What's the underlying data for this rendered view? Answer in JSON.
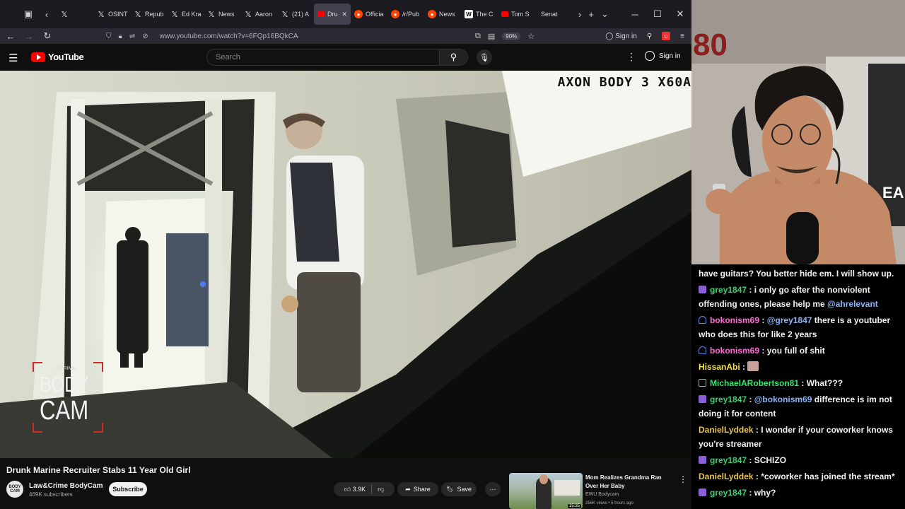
{
  "browser": {
    "tabs": [
      {
        "label": "",
        "icon": "x-logo",
        "type": "x",
        "active": false
      },
      {
        "label": "OSINT",
        "icon": "x-logo",
        "type": "x",
        "active": false
      },
      {
        "label": "Repub",
        "icon": "x-logo",
        "type": "x",
        "active": false
      },
      {
        "label": "Ed Kra",
        "icon": "x-logo",
        "type": "x",
        "active": false
      },
      {
        "label": "News",
        "icon": "x-logo",
        "type": "x",
        "active": false
      },
      {
        "label": "Aaron",
        "icon": "x-logo",
        "type": "x",
        "active": false
      },
      {
        "label": "(21) A",
        "icon": "x-logo",
        "type": "x",
        "active": false
      },
      {
        "label": "Dru",
        "icon": "youtube-logo",
        "type": "yt",
        "active": true
      },
      {
        "label": "Officia",
        "icon": "reddit-logo",
        "type": "rd",
        "active": false
      },
      {
        "label": "/r/Pub",
        "icon": "reddit-logo",
        "type": "rd",
        "active": false
      },
      {
        "label": "News",
        "icon": "reddit-logo",
        "type": "rd",
        "active": false
      },
      {
        "label": "The C",
        "icon": "wikipedia-logo",
        "type": "w",
        "active": false
      },
      {
        "label": "Tom S",
        "icon": "youtube-logo",
        "type": "yt",
        "active": false
      },
      {
        "label": "Senat",
        "icon": "",
        "type": "none",
        "active": false
      }
    ],
    "url": "www.youtube.com/watch?v=6FQp16BQkCA",
    "zoom": "90%",
    "sign_in": "Sign in"
  },
  "youtube": {
    "logo_text": "YouTube",
    "search_placeholder": "Search",
    "sign_in": "Sign in"
  },
  "video": {
    "overlay_text": "AXON BODY 3  X60A",
    "watermark_small": "& CRIME",
    "watermark_line1": "BODY",
    "watermark_line2": "CAM",
    "title": "Drunk Marine Recruiter Stabs 11 Year Old Girl",
    "channel": "Law&Crime BodyCam",
    "channel_avatar_text": "BODY CAM",
    "subscribers": "469K subscribers",
    "subscribe_label": "Subscribe",
    "likes": "3.9K",
    "share_label": "Share",
    "save_label": "Save"
  },
  "recommendation": {
    "title": "Mom Realizes Grandma Ran Over Her Baby",
    "channel": "EWU Bodycam",
    "meta": "258K views • 5 hours ago",
    "duration": "15:35"
  },
  "chat": {
    "messages": [
      {
        "user": "",
        "color": "#f2f2f2",
        "badge": "",
        "parts": [
          {
            "t": "text",
            "v": "have guitars? You better hide em. I will show up."
          }
        ]
      },
      {
        "user": "grey1847",
        "color": "#3bd16f",
        "badge": "sub",
        "parts": [
          {
            "t": "text",
            "v": "i only go after the nonviolent offending ones, please help me "
          },
          {
            "t": "mention",
            "v": "@ahrelevant"
          }
        ]
      },
      {
        "user": "bokonism69",
        "color": "#ff6bd6",
        "badge": "user",
        "parts": [
          {
            "t": "mention",
            "v": "@grey1847"
          },
          {
            "t": "text",
            "v": " there is a youtuber who does this for like 2 years"
          }
        ]
      },
      {
        "user": "bokonism69",
        "color": "#ff6bd6",
        "badge": "user",
        "parts": [
          {
            "t": "text",
            "v": "you full of shit"
          }
        ]
      },
      {
        "user": "HissanAbi",
        "color": "#f5e642",
        "badge": "",
        "parts": [
          {
            "t": "emote",
            "v": "emote"
          }
        ]
      },
      {
        "user": "MichaelARobertson81",
        "color": "#2ee86a",
        "badge": "eye",
        "parts": [
          {
            "t": "text",
            "v": "What???"
          }
        ]
      },
      {
        "user": "grey1847",
        "color": "#3bd16f",
        "badge": "sub",
        "parts": [
          {
            "t": "mention",
            "v": "@bokonism69"
          },
          {
            "t": "text",
            "v": " difference is im not doing it for content"
          }
        ]
      },
      {
        "user": "DanielLyddek",
        "color": "#e8c35a",
        "badge": "",
        "parts": [
          {
            "t": "text",
            "v": "I wonder if your coworker knows you're streamer"
          }
        ]
      },
      {
        "user": "grey1847",
        "color": "#3bd16f",
        "badge": "sub",
        "parts": [
          {
            "t": "text",
            "v": "SCHIZO"
          }
        ]
      },
      {
        "user": "DanielLyddek",
        "color": "#e8c35a",
        "badge": "",
        "parts": [
          {
            "t": "text",
            "v": "*coworker has joined the stream*"
          }
        ]
      },
      {
        "user": "grey1847",
        "color": "#3bd16f",
        "badge": "sub",
        "parts": [
          {
            "t": "text",
            "v": "why?"
          }
        ]
      }
    ]
  },
  "webcam": {
    "wall_text": "80",
    "poster_text": "EA"
  }
}
